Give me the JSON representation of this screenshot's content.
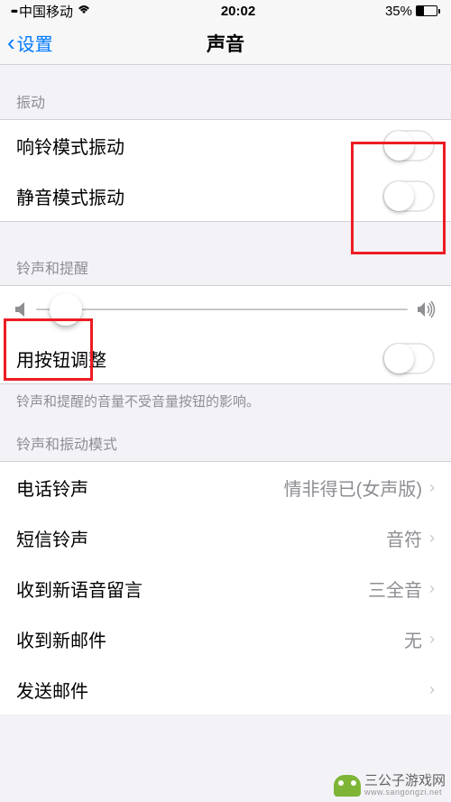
{
  "statusbar": {
    "carrier": "中国移动",
    "time": "20:02",
    "battery_pct": "35%"
  },
  "nav": {
    "back_label": "设置",
    "title": "声音"
  },
  "sections": {
    "vibrate": {
      "header": "振动",
      "ring_vibrate": "响铃模式振动",
      "silent_vibrate": "静音模式振动"
    },
    "ringer": {
      "header": "铃声和提醒",
      "adjust_with_buttons": "用按钮调整",
      "footer": "铃声和提醒的音量不受音量按钮的影响。"
    },
    "patterns": {
      "header": "铃声和振动模式",
      "phone_ringtone": {
        "label": "电话铃声",
        "value": "情非得已(女声版)"
      },
      "text_tone": {
        "label": "短信铃声",
        "value": "音符"
      },
      "voicemail": {
        "label": "收到新语音留言",
        "value": "三全音"
      },
      "new_mail": {
        "label": "收到新邮件",
        "value": "无"
      },
      "sent_mail": {
        "label": "发送邮件",
        "value": ""
      }
    }
  },
  "watermark": {
    "brand": "三公子游戏网",
    "domain": "www.sangongzi.net"
  }
}
